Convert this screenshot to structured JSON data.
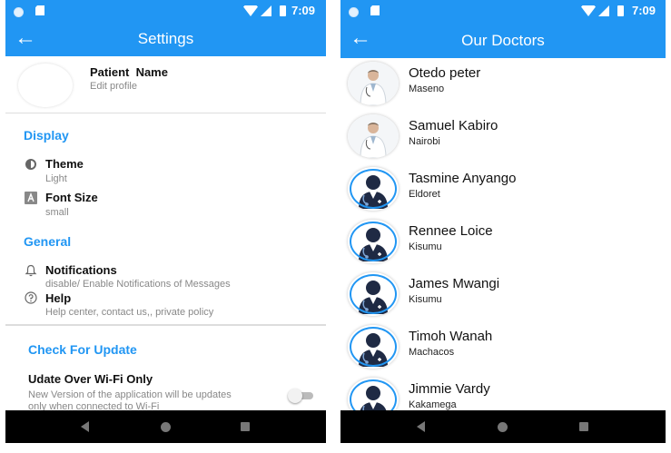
{
  "status_bar": {
    "time": "7:09"
  },
  "settings": {
    "title": "Settings",
    "profile": {
      "name": "Patient  Name",
      "subtitle": "Edit profile"
    },
    "display": {
      "title": "Display",
      "theme": {
        "label": "Theme",
        "value": "Light"
      },
      "font_size": {
        "label": "Font Size",
        "value": "small"
      }
    },
    "general": {
      "title": "General",
      "notifications": {
        "label": "Notifications",
        "description": "disable/ Enable Notifications of Messages"
      },
      "help": {
        "label": "Help",
        "description": "Help center, contact us,, private policy"
      }
    },
    "check_update": {
      "title": "Check For Update",
      "wifi_only": {
        "label": "Udate Over  Wi-Fi Only",
        "description_line1": "New Version of the application will be updates",
        "description_line2": "only when connected to Wi-Fi",
        "enabled": false
      }
    }
  },
  "doctors": {
    "title": "Our Doctors",
    "list": [
      {
        "name": "Otedo peter",
        "location": "Maseno",
        "avatar": "doctor-photo"
      },
      {
        "name": "Samuel Kabiro",
        "location": "Nairobi",
        "avatar": "doctor-photo"
      },
      {
        "name": "Tasmine Anyango",
        "location": "Eldoret",
        "avatar": "doctor-silhouette-icon"
      },
      {
        "name": "Rennee Loice",
        "location": "Kisumu",
        "avatar": "doctor-silhouette-icon"
      },
      {
        "name": "James Mwangi",
        "location": "Kisumu",
        "avatar": "doctor-silhouette-icon"
      },
      {
        "name": "Timoh Wanah",
        "location": "Machacos",
        "avatar": "doctor-silhouette-icon"
      },
      {
        "name": "Jimmie Vardy",
        "location": "Kakamega",
        "avatar": "doctor-silhouette-icon"
      }
    ]
  },
  "colors": {
    "primary": "#2196f3",
    "nav_bar": "#000000",
    "divider": "#dddddd"
  }
}
